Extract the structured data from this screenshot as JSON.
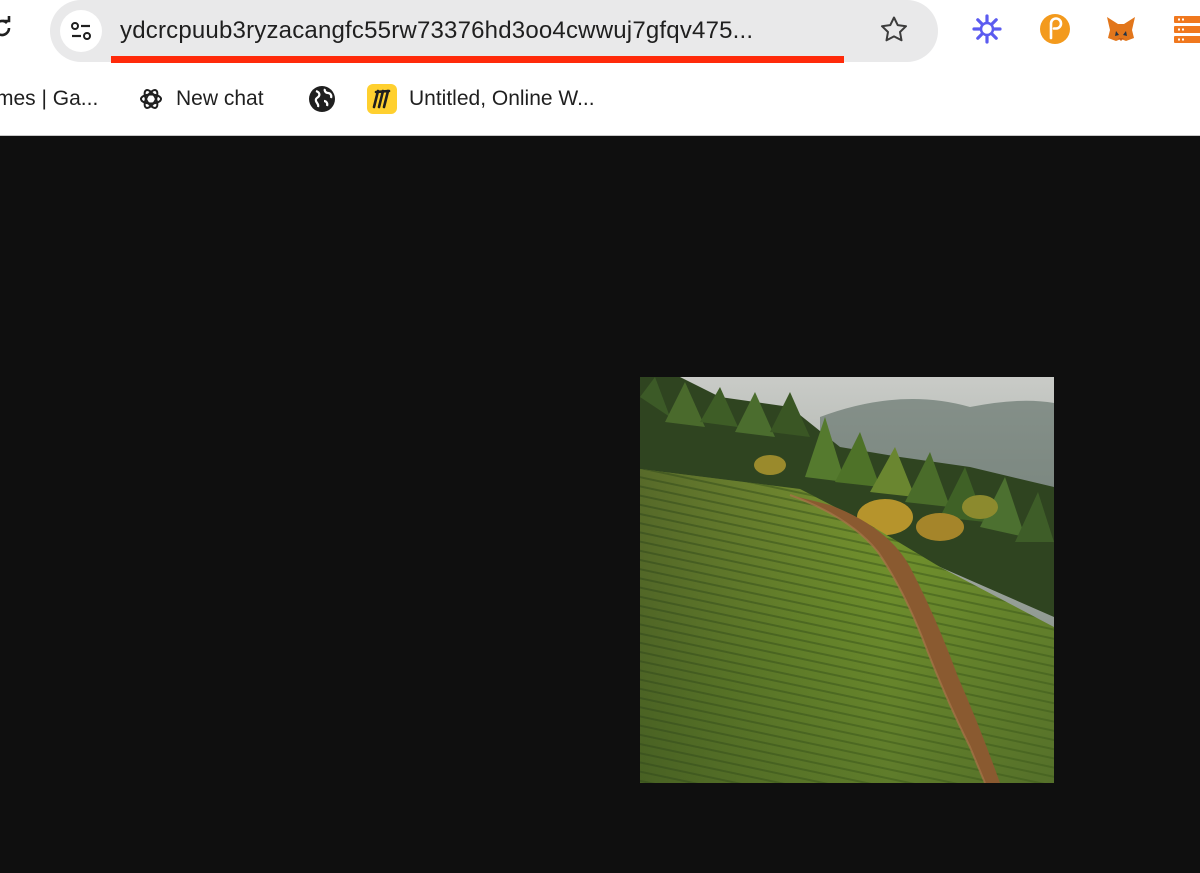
{
  "omnibox": {
    "url": "ydcrcpuub3ryzacangfc55rw73376hd3oo4cwwuj7gfqv475..."
  },
  "bookmarks": [
    {
      "label": "mes | Ga...",
      "icon": "none"
    },
    {
      "label": "New chat",
      "icon": "openai-icon"
    },
    {
      "label": "",
      "icon": "globe-icon"
    },
    {
      "label": "Untitled, Online W...",
      "icon": "miro-icon"
    }
  ],
  "extensions": [
    {
      "name": "perplexity-icon",
      "color": "#5b5bf0"
    },
    {
      "name": "polkadot-icon",
      "color": "#f39a1d"
    },
    {
      "name": "metamask-icon",
      "color": "#e2761b"
    },
    {
      "name": "server-icon",
      "color": "#f0781e"
    }
  ],
  "colors": {
    "url_underline": "#ff2a0a",
    "page_background": "#0f0f0f"
  },
  "image": {
    "subject": "rolling green fields with dirt path and forest"
  }
}
